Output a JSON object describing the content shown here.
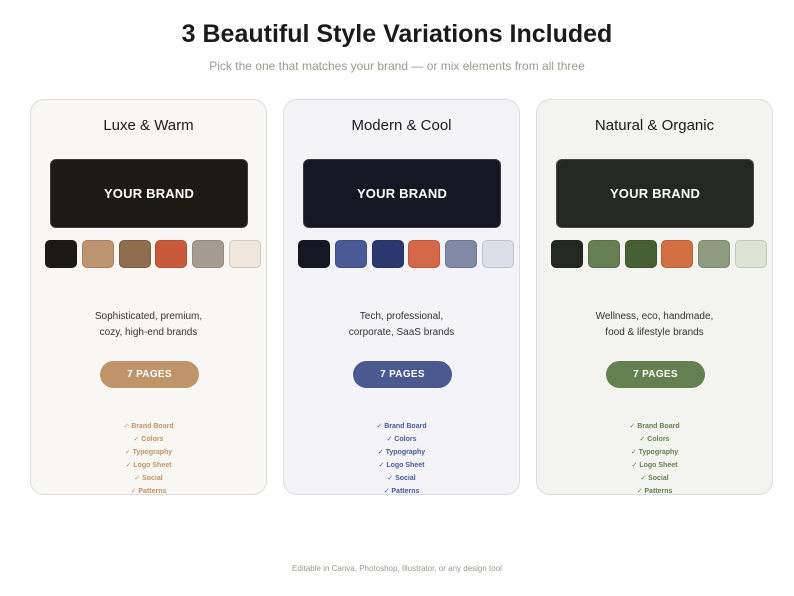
{
  "header": {
    "title": "3 Beautiful Style Variations Included",
    "subtitle": "Pick the one that matches your brand — or mix elements from all three"
  },
  "cards": [
    {
      "title": "Luxe & Warm",
      "brand_text": "YOUR BRAND",
      "brand_bg": "#1d1a16",
      "card_bg": "#f8f7f4",
      "swatches": [
        "#1d1a16",
        "#bd9570",
        "#8e6c4d",
        "#c9593b",
        "#a49d8f",
        "#efe7dd"
      ],
      "desc_lines": [
        "Sophisticated, premium,",
        "cozy, high-end brands"
      ],
      "pages_label": "7 PAGES",
      "accent": "#bf9468",
      "features": [
        "✓ Brand Board",
        "✓ Colors",
        "✓ Typography",
        "✓ Logo Sheet",
        "✓ Social",
        "✓ Patterns"
      ]
    },
    {
      "title": "Modern & Cool",
      "brand_text": "YOUR BRAND",
      "brand_bg": "#161722",
      "card_bg": "#f3f3f8",
      "swatches": [
        "#161722",
        "#4a5a96",
        "#2b3870",
        "#d6684a",
        "#8089a6",
        "#dcdfe7"
      ],
      "desc_lines": [
        "Tech, professional,",
        "corporate, SaaS brands"
      ],
      "pages_label": "7 PAGES",
      "accent": "#4a5a91",
      "features": [
        "✓ Brand Board",
        "✓ Colors",
        "✓ Typography",
        "✓ Logo Sheet",
        "✓ Social",
        "✓ Patterns"
      ]
    },
    {
      "title": "Natural & Organic",
      "brand_text": "YOUR BRAND",
      "brand_bg": "#232820",
      "card_bg": "#f3f4ef",
      "swatches": [
        "#232820",
        "#667f52",
        "#465f33",
        "#d16f43",
        "#8d9c7e",
        "#dde4d5"
      ],
      "desc_lines": [
        "Wellness, eco, handmade,",
        "food & lifestyle brands"
      ],
      "pages_label": "7 PAGES",
      "accent": "#647f50",
      "features": [
        "✓ Brand Board",
        "✓ Colors",
        "✓ Typography",
        "✓ Logo Sheet",
        "✓ Social",
        "✓ Patterns"
      ]
    }
  ],
  "footer": {
    "text": "Editable in Canva, Photoshop, Illustrator, or any design tool"
  }
}
